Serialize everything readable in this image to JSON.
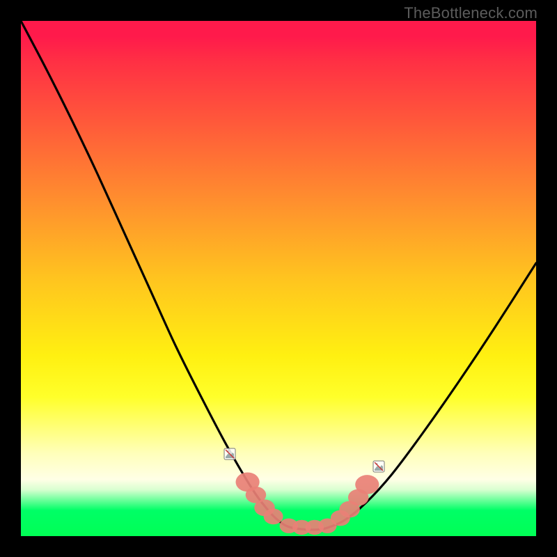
{
  "attribution": "TheBottleneck.com",
  "colors": {
    "top": "#ff1a4b",
    "mid": "#ffe011",
    "bottom": "#00ff55",
    "frame": "#000000",
    "curve": "#000000",
    "bead": "#e98076"
  },
  "chart_data": {
    "type": "line",
    "title": "",
    "xlabel": "",
    "ylabel": "",
    "xlim": [
      0,
      100
    ],
    "ylim": [
      0,
      100
    ],
    "grid": false,
    "legend": false,
    "series": [
      {
        "name": "bottleneck-curve",
        "x": [
          0,
          5,
          10,
          15,
          20,
          25,
          30,
          35,
          40,
          45,
          48,
          50,
          52,
          55,
          58,
          60,
          63,
          67,
          72,
          78,
          85,
          92,
          100
        ],
        "y": [
          100,
          90.5,
          80.5,
          70,
          59,
          48,
          37,
          27,
          17.5,
          9,
          5,
          3,
          1.8,
          1.3,
          1.3,
          1.8,
          3.2,
          6.5,
          12,
          20,
          30,
          40.5,
          53
        ]
      }
    ],
    "markers": [
      {
        "name": "left-bead-1",
        "x": 44.0,
        "y": 10.5,
        "r": 2.2
      },
      {
        "name": "left-bead-2",
        "x": 45.6,
        "y": 8.0,
        "r": 1.9
      },
      {
        "name": "left-bead-3",
        "x": 47.3,
        "y": 5.5,
        "r": 1.9
      },
      {
        "name": "left-bead-4",
        "x": 49.0,
        "y": 3.8,
        "r": 1.8
      },
      {
        "name": "flat-bead-1",
        "x": 52.0,
        "y": 2.0,
        "r": 1.7
      },
      {
        "name": "flat-bead-2",
        "x": 54.5,
        "y": 1.7,
        "r": 1.7
      },
      {
        "name": "flat-bead-3",
        "x": 57.0,
        "y": 1.7,
        "r": 1.7
      },
      {
        "name": "flat-bead-4",
        "x": 59.5,
        "y": 2.0,
        "r": 1.7
      },
      {
        "name": "right-bead-1",
        "x": 62.0,
        "y": 3.5,
        "r": 1.8
      },
      {
        "name": "right-bead-2",
        "x": 63.8,
        "y": 5.2,
        "r": 1.9
      },
      {
        "name": "right-bead-3",
        "x": 65.5,
        "y": 7.5,
        "r": 1.9
      },
      {
        "name": "right-bead-4",
        "x": 67.2,
        "y": 10.0,
        "r": 2.2
      }
    ],
    "null_icons": [
      {
        "name": "null-icon-left",
        "x": 40.5,
        "y": 16.0
      },
      {
        "name": "null-icon-right",
        "x": 69.5,
        "y": 13.5
      }
    ]
  }
}
